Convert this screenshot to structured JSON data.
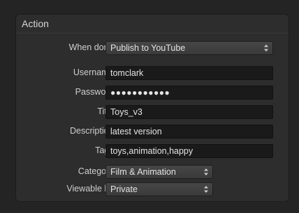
{
  "section": {
    "title": "Action"
  },
  "fields": {
    "when_done": {
      "label": "When done:",
      "value": "Publish to YouTube"
    },
    "username": {
      "label": "Username:",
      "value": "tomclark"
    },
    "password": {
      "label": "Password:",
      "value": "●●●●●●●●●●●"
    },
    "title": {
      "label": "Title:",
      "value": "Toys_v3"
    },
    "description": {
      "label": "Description:",
      "value": "latest version"
    },
    "tags": {
      "label": "Tags:",
      "value": "toys,animation,happy"
    },
    "category": {
      "label": "Category:",
      "value": "Film & Animation"
    },
    "viewable_by": {
      "label": "Viewable by:",
      "value": "Private"
    }
  },
  "icons": {
    "popup_arrows": "up-down-chevron-icon"
  },
  "colors": {
    "panel": "#2d2d2d",
    "field": "#1a1a1a",
    "text": "#e4e4e4"
  }
}
